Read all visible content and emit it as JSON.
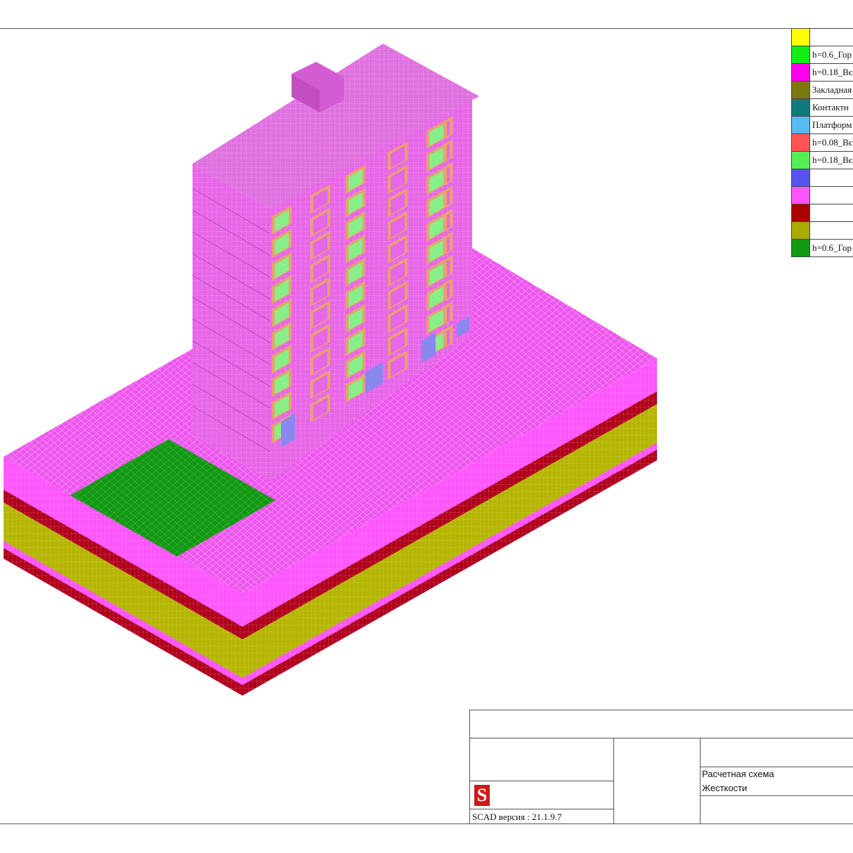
{
  "legend": {
    "rows": [
      {
        "color": "#ffff00",
        "label": ""
      },
      {
        "color": "#11ee11",
        "label": "h=0.6_Гор"
      },
      {
        "color": "#ff00ee",
        "label": "h=0.18_Вє"
      },
      {
        "color": "#7a7a10",
        "label": "Закладная"
      },
      {
        "color": "#117a7a",
        "label": "Контактн"
      },
      {
        "color": "#55bbf0",
        "label": "Платформ"
      },
      {
        "color": "#ff5555",
        "label": "h=0.08_Вє"
      },
      {
        "color": "#55ee55",
        "label": "h=0.18_Вє"
      },
      {
        "color": "#5555ee",
        "label": ""
      },
      {
        "color": "#ff55ff",
        "label": ""
      },
      {
        "color": "#aa0000",
        "label": ""
      },
      {
        "color": "#aaaa00",
        "label": ""
      },
      {
        "color": "#119911",
        "label": "h=0.6_Гор"
      }
    ]
  },
  "title_block": {
    "scheme_title": "Расчетная схема",
    "scheme_subtitle": "Жесткости",
    "version": "SCAD версия : 21.1.9.7",
    "logo_letter": "S"
  },
  "colors": {
    "soil_top": "#ee55ee",
    "soil_magenta": "#ff55ff",
    "soil_red": "#b0001a",
    "soil_olive": "#b5b500",
    "slab_green": "#119911",
    "building": "#e866e8",
    "window_frame": "#e8a070",
    "window_glass": "#88ee88",
    "openings": "#8888ee"
  }
}
